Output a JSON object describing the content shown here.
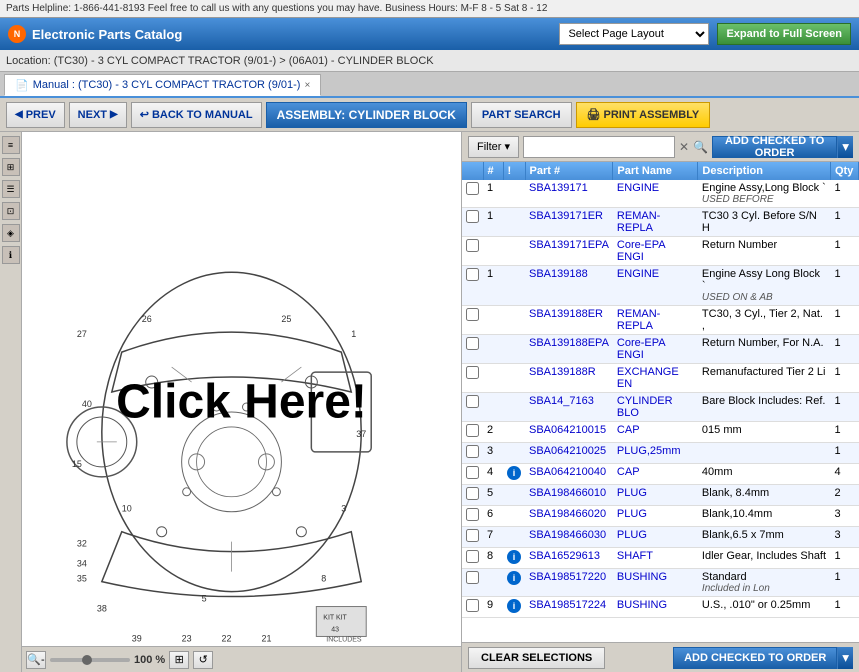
{
  "topbar": {
    "text": "Parts Helpline: 1-866-441-8193 Feel free to call us with any questions you may have. Business Hours: M-F 8 - 5 Sat 8 - 12"
  },
  "header": {
    "app_title": "Electronic Parts Catalog",
    "logo_text": "N",
    "page_layout_placeholder": "Select Page Layout",
    "expand_btn": "Expand to Full Screen"
  },
  "location": {
    "text": "Location: (TC30) - 3 CYL COMPACT TRACTOR (9/01-) > (06A01) - CYLINDER BLOCK"
  },
  "tab": {
    "label": "Manual : (TC30) - 3 CYL COMPACT TRACTOR (9/01-)",
    "close": "×"
  },
  "toolbar": {
    "prev": "PREV",
    "next": "NEXT",
    "back_to_manual": "BACK TO MANUAL",
    "assembly": "ASSEMBLY: CYLINDER BLOCK",
    "part_search": "PART SEARCH",
    "print_assembly": "PRINT ASSEMBLY"
  },
  "filter": {
    "label": "Filter",
    "placeholder": "",
    "add_to_order": "ADD CHECKED TO ORDER"
  },
  "table": {
    "headers": [
      "",
      "#",
      "!",
      "Part #",
      "Part Name",
      "Description",
      "Qty"
    ],
    "rows": [
      {
        "check": false,
        "num": "1",
        "info": false,
        "part": "SBA139171",
        "name": "ENGINE",
        "desc": "Engine Assy,Long Block `",
        "qty": "1",
        "note": "USED BEFORE"
      },
      {
        "check": false,
        "num": "1",
        "info": false,
        "part": "SBA139171ER",
        "name": "REMAN-REPLA",
        "desc": "TC30 3 Cyl. Before S/N H",
        "qty": "1",
        "note": ""
      },
      {
        "check": false,
        "num": "",
        "info": false,
        "part": "SBA139171EPA",
        "name": "Core-EPA ENGI",
        "desc": "Return Number",
        "qty": "1",
        "note": ""
      },
      {
        "check": false,
        "num": "1",
        "info": false,
        "part": "SBA139188",
        "name": "ENGINE",
        "desc": "Engine Assy Long Block `",
        "qty": "1",
        "note": "USED ON & AB"
      },
      {
        "check": false,
        "num": "",
        "info": false,
        "part": "SBA139188ER",
        "name": "REMAN-REPLA",
        "desc": "TC30, 3 Cyl., Tier 2, Nat. ,",
        "qty": "1",
        "note": ""
      },
      {
        "check": false,
        "num": "",
        "info": false,
        "part": "SBA139188EPA",
        "name": "Core-EPA ENGI",
        "desc": "Return Number, For N.A.",
        "qty": "1",
        "note": ""
      },
      {
        "check": false,
        "num": "",
        "info": false,
        "part": "SBA139188R",
        "name": "EXCHANGE EN",
        "desc": "Remanufactured Tier 2 Li",
        "qty": "1",
        "note": ""
      },
      {
        "check": false,
        "num": "",
        "info": false,
        "part": "SBA14_7163",
        "name": "CYLINDER BLO",
        "desc": "Bare Block Includes: Ref.",
        "qty": "1",
        "note": ""
      },
      {
        "check": false,
        "num": "2",
        "info": false,
        "part": "SBA064210015",
        "name": "CAP",
        "desc": "015 mm",
        "qty": "1",
        "note": ""
      },
      {
        "check": false,
        "num": "3",
        "info": false,
        "part": "SBA064210025",
        "name": "PLUG,25mm",
        "desc": "",
        "qty": "1",
        "note": ""
      },
      {
        "check": false,
        "num": "4",
        "info": true,
        "part": "SBA064210040",
        "name": "CAP",
        "desc": "40mm",
        "qty": "4",
        "note": ""
      },
      {
        "check": false,
        "num": "5",
        "info": false,
        "part": "SBA198466010",
        "name": "PLUG",
        "desc": "Blank, 8.4mm",
        "qty": "2",
        "note": ""
      },
      {
        "check": false,
        "num": "6",
        "info": false,
        "part": "SBA198466020",
        "name": "PLUG",
        "desc": "Blank,10.4mm",
        "qty": "3",
        "note": ""
      },
      {
        "check": false,
        "num": "7",
        "info": false,
        "part": "SBA198466030",
        "name": "PLUG",
        "desc": "Blank,6.5 x 7mm",
        "qty": "3",
        "note": ""
      },
      {
        "check": false,
        "num": "8",
        "info": true,
        "part": "SBA16529613",
        "name": "SHAFT",
        "desc": "Idler Gear, Includes Shaft",
        "qty": "1",
        "note": ""
      },
      {
        "check": false,
        "num": "",
        "info": true,
        "part": "SBA198517220",
        "name": "BUSHING",
        "desc": "Standard",
        "qty": "1",
        "note": "Included in Lon"
      },
      {
        "check": false,
        "num": "9",
        "info": true,
        "part": "SBA198517224",
        "name": "BUSHING",
        "desc": "U.S., .010\" or 0.25mm",
        "qty": "1",
        "note": ""
      }
    ]
  },
  "diagram": {
    "zoom_pct": "100 %",
    "click_here": "Click Here!"
  },
  "bottom": {
    "clear_btn": "CLEAR SELECTIONS",
    "add_to_order": "ADD CHECKED TO ORDER"
  }
}
